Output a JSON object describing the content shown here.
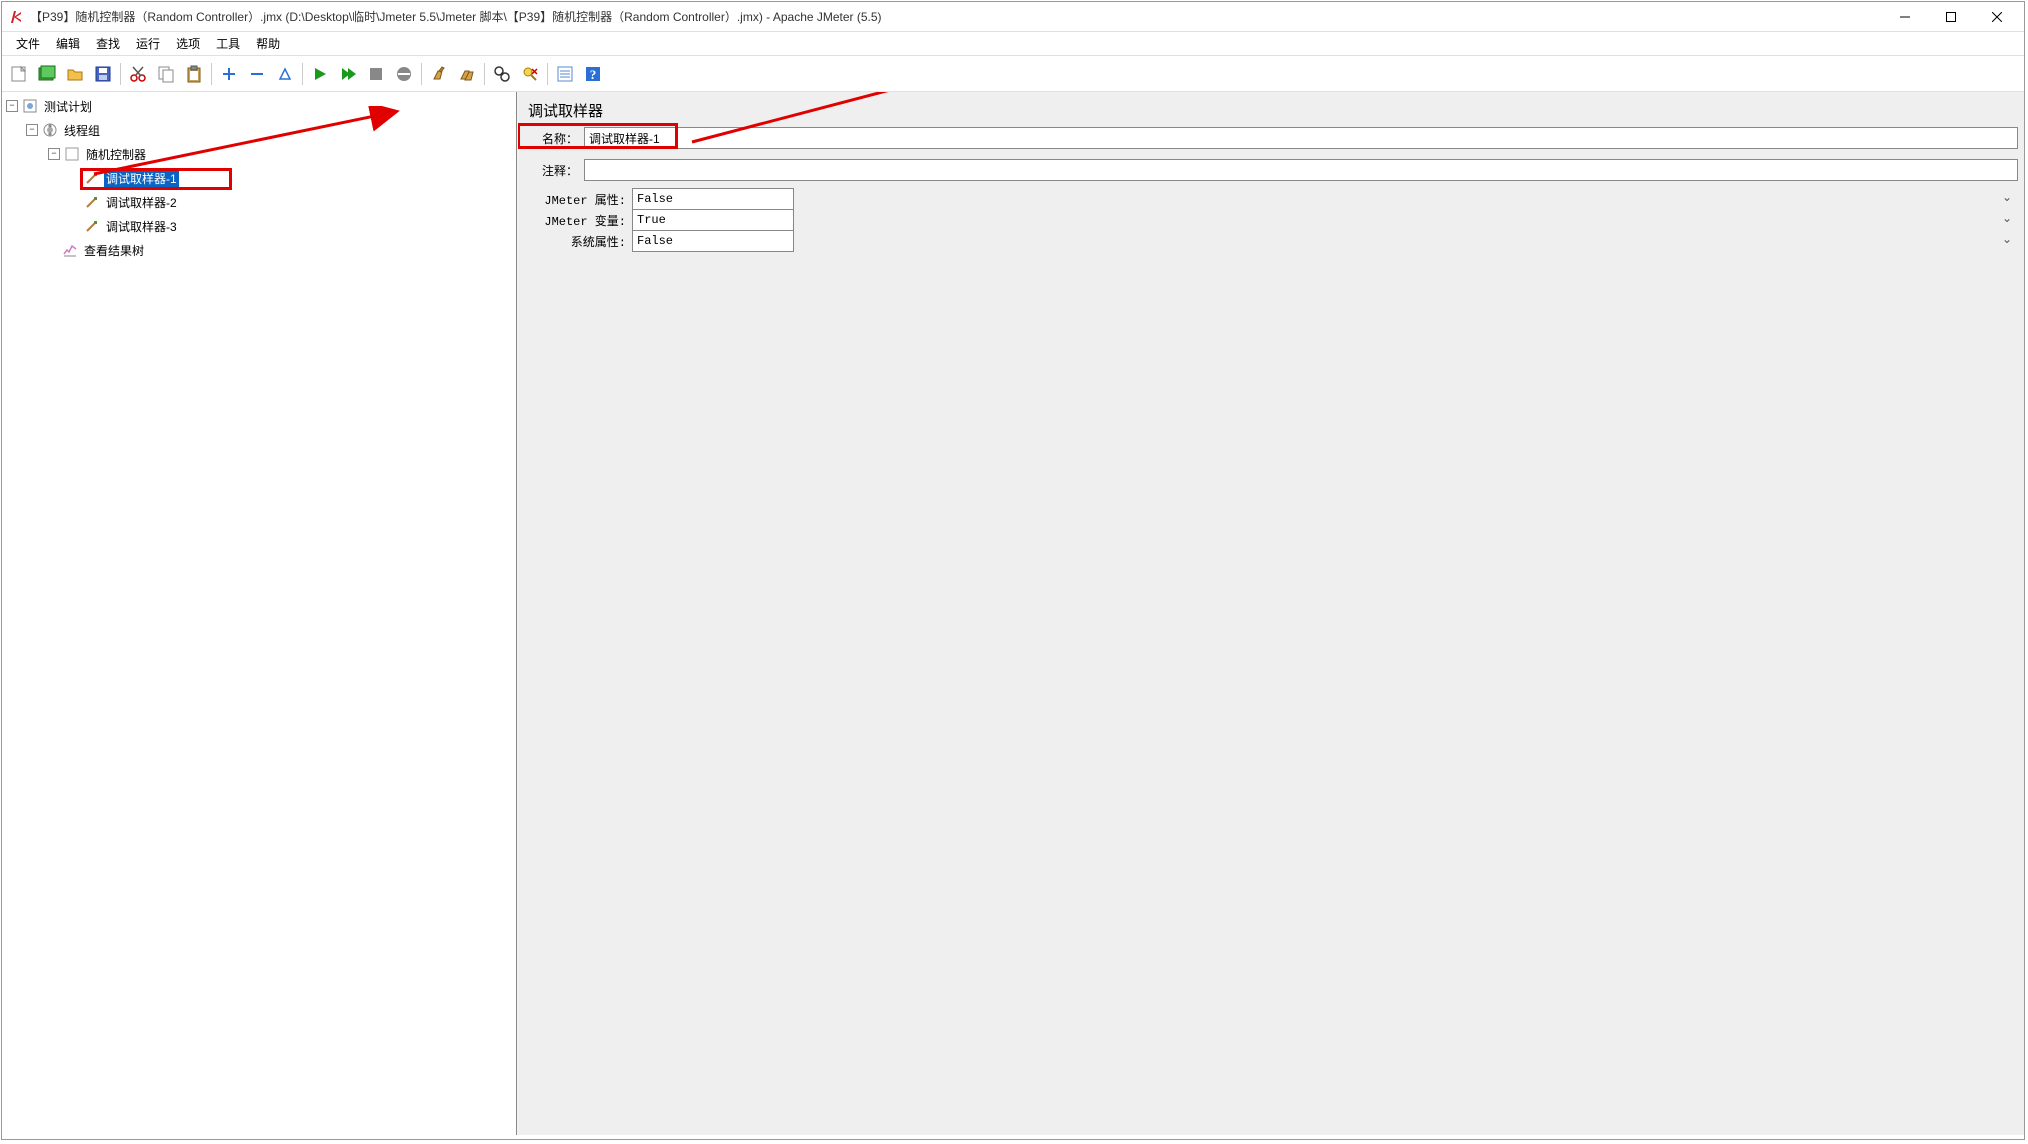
{
  "window": {
    "title": "【P39】随机控制器（Random Controller）.jmx (D:\\Desktop\\临时\\Jmeter 5.5\\Jmeter 脚本\\【P39】随机控制器（Random Controller）.jmx) - Apache JMeter (5.5)"
  },
  "menu": {
    "file": "文件",
    "edit": "编辑",
    "search": "查找",
    "run": "运行",
    "options": "选项",
    "tools": "工具",
    "help": "帮助"
  },
  "tree": {
    "test_plan": "测试计划",
    "thread_group": "线程组",
    "random_controller": "随机控制器",
    "sampler1": "调试取样器-1",
    "sampler2": "调试取样器-2",
    "sampler3": "调试取样器-3",
    "view_results": "查看结果树"
  },
  "panel": {
    "heading": "调试取样器",
    "name_label": "名称：",
    "name_value": "调试取样器-1",
    "comment_label": "注释：",
    "comment_value": "",
    "jmeter_props_label": "JMeter 属性:",
    "jmeter_props_value": "False",
    "jmeter_vars_label": "JMeter 变量:",
    "jmeter_vars_value": "True",
    "system_props_label": "系统属性:",
    "system_props_value": "False"
  }
}
